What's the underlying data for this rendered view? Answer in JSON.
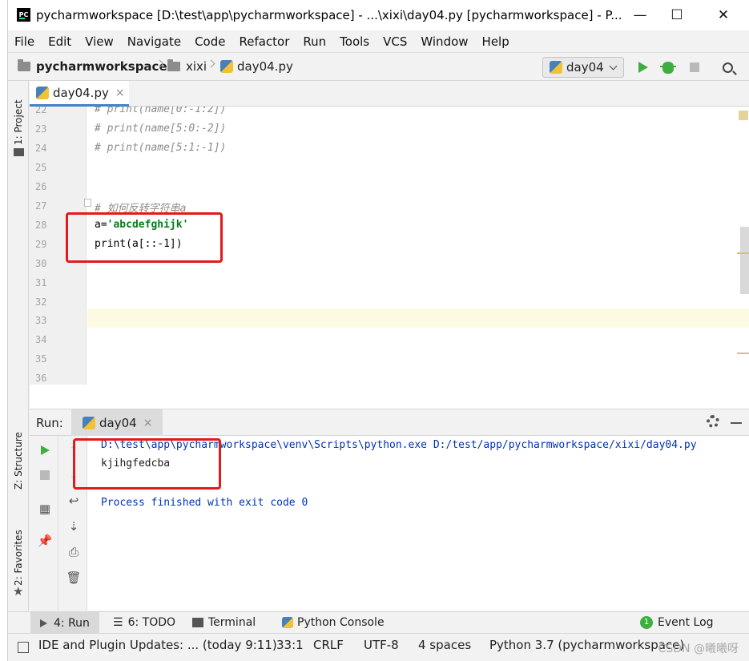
{
  "window": {
    "title": "pycharmworkspace [D:\\test\\app\\pycharmworkspace] - ...\\xixi\\day04.py [pycharmworkspace] - P...",
    "logo_text": "PC",
    "controls": {
      "minimize": "—",
      "maximize": "☐",
      "close": "✕"
    }
  },
  "menu": [
    "File",
    "Edit",
    "View",
    "Navigate",
    "Code",
    "Refactor",
    "Run",
    "Tools",
    "VCS",
    "Window",
    "Help"
  ],
  "breadcrumb": {
    "project": "pycharmworkspace",
    "folder": "xixi",
    "file": "day04.py"
  },
  "run_config": {
    "selected": "day04"
  },
  "left_strip": {
    "project": "1: Project",
    "structure": "Z: Structure",
    "favorites": "2: Favorites"
  },
  "editor": {
    "tab_label": "day04.py",
    "tab_close": "×",
    "lines": [
      {
        "no": "22",
        "text": "# print(name[0:-1:2])"
      },
      {
        "no": "23",
        "text": "# print(name[5:0:-2])"
      },
      {
        "no": "24",
        "text": "# print(name[5:1:-1])"
      },
      {
        "no": "25",
        "text": ""
      },
      {
        "no": "26",
        "text": ""
      },
      {
        "no": "27",
        "text": "# 如何反转字符串a"
      },
      {
        "no": "28",
        "text": "a='abcdefghijk'"
      },
      {
        "no": "29",
        "text": "print(a[::-1])"
      },
      {
        "no": "30",
        "text": ""
      },
      {
        "no": "31",
        "text": ""
      },
      {
        "no": "32",
        "text": ""
      },
      {
        "no": "33",
        "text": ""
      },
      {
        "no": "34",
        "text": ""
      },
      {
        "no": "35",
        "text": ""
      },
      {
        "no": "36",
        "text": ""
      }
    ],
    "line28_prefix": "a=",
    "line28_string": "'abcdefghijk'"
  },
  "run_panel": {
    "label": "Run:",
    "tab_label": "day04",
    "tab_close": "×",
    "console": {
      "command": "D:\\test\\app\\pycharmworkspace\\venv\\Scripts\\python.exe D:/test/app/pycharmworkspace/xixi/day04.py",
      "output": "kjihgfedcba",
      "finish": "Process finished with exit code 0"
    }
  },
  "bottom_tools": {
    "run": "4: Run",
    "todo": "6: TODO",
    "terminal": "Terminal",
    "python_console": "Python Console",
    "event_log": "Event Log",
    "event_count": "1"
  },
  "status": {
    "updates": "IDE and Plugin Updates: ... (today 9:11)",
    "position": "33:1",
    "line_sep": "CRLF",
    "encoding": "UTF-8",
    "indent": "4 spaces",
    "interpreter": "Python 3.7 (pycharmworkspace)",
    "watermark": "CSDN @曦曦呀"
  },
  "colors": {
    "comment": "#8c8c8c",
    "string": "#067d17",
    "console_blue": "#0033b3",
    "current_line": "#fcfae1",
    "highlight_box": "#e31a1a",
    "run_green": "#3fae40"
  }
}
